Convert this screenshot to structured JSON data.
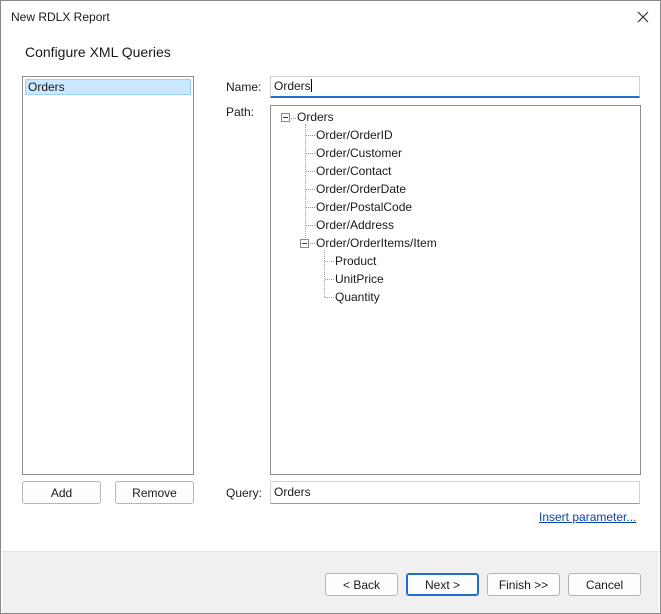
{
  "window": {
    "title": "New RDLX Report"
  },
  "page": {
    "heading": "Configure XML Queries"
  },
  "queries": {
    "items": [
      "Orders"
    ],
    "add_label": "Add",
    "remove_label": "Remove"
  },
  "form": {
    "name_label": "Name:",
    "name_value": "Orders",
    "path_label": "Path:",
    "query_label": "Query:",
    "query_value": "Orders",
    "insert_parameter_label": "Insert parameter..."
  },
  "tree": {
    "root": "Orders",
    "children": [
      "Order/OrderID",
      "Order/Customer",
      "Order/Contact",
      "Order/OrderDate",
      "Order/PostalCode",
      "Order/Address",
      "Order/OrderItems/Item"
    ],
    "grandchildren": [
      "Product",
      "UnitPrice",
      "Quantity"
    ]
  },
  "footer": {
    "back_label": "< Back",
    "next_label": "Next >",
    "finish_label": "Finish >>",
    "cancel_label": "Cancel"
  },
  "icons": {
    "close": "close-icon",
    "collapse": "minus-square-icon"
  }
}
